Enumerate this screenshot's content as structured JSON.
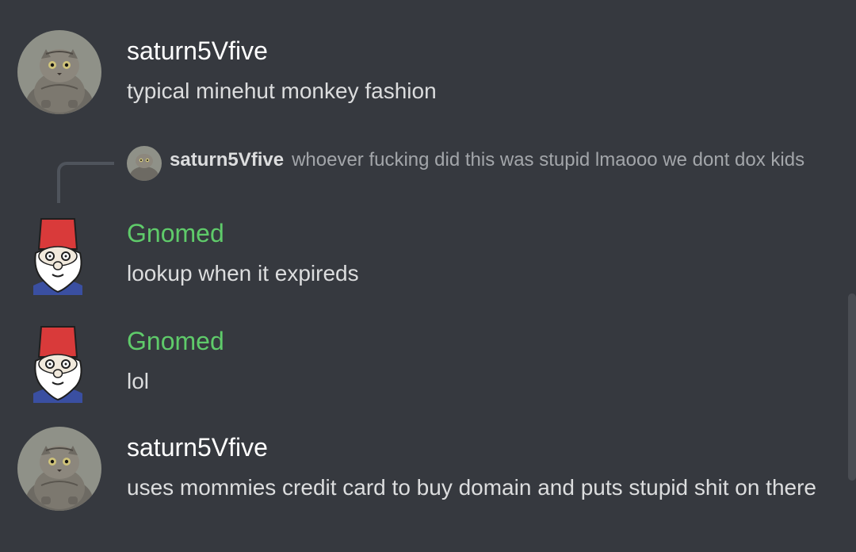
{
  "colors": {
    "background": "#36393f",
    "username_default": "#ffffff",
    "username_green": "#5fcb6a",
    "message_text": "#dcddde",
    "reply_text": "#a3a6aa"
  },
  "messages": [
    {
      "author": "saturn5Vfive",
      "avatar": "cat-avatar",
      "text": "typical minehut monkey fashion"
    },
    {
      "reply_to": {
        "author": "saturn5Vfive",
        "avatar": "cat-avatar",
        "text": "whoever fucking did this was stupid lmaooo we dont dox kids"
      },
      "author": "Gnomed",
      "avatar": "gnome-avatar",
      "text": "lookup when it expireds"
    },
    {
      "author": "Gnomed",
      "avatar": "gnome-avatar",
      "text": "lol"
    },
    {
      "author": "saturn5Vfive",
      "avatar": "cat-avatar",
      "text": "uses mommies credit card to buy domain and puts stupid shit on there"
    }
  ]
}
